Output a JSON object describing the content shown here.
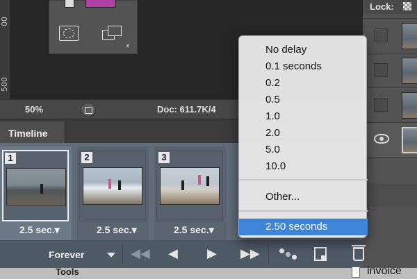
{
  "canvas": {
    "ruler_labels": [
      "00",
      "500"
    ],
    "swatch_colors": {
      "foreground": "#b03fa6",
      "background": "#dddddd"
    }
  },
  "status_bar": {
    "zoom": "50%",
    "doc_info": "Doc: 611.7K/4"
  },
  "layers": {
    "lock_label": "Lock:"
  },
  "timeline": {
    "tab_label": "Timeline",
    "frames": [
      {
        "number": "1",
        "delay": "2.5 sec.",
        "selected": true
      },
      {
        "number": "2",
        "delay": "2.5 sec.",
        "selected": false
      },
      {
        "number": "3",
        "delay": "2.5 sec.",
        "selected": false
      }
    ],
    "loop_label": "Forever",
    "controls": [
      "first-frame",
      "previous-frame",
      "play",
      "next-frame",
      "tween",
      "duplicate-frame",
      "delete-frame"
    ]
  },
  "delay_menu": {
    "items": [
      "No delay",
      "0.1 seconds",
      "0.2",
      "0.5",
      "1.0",
      "2.0",
      "5.0",
      "10.0"
    ],
    "other_label": "Other...",
    "current_label": "2.50 seconds",
    "highlight_color": "#3d84d8"
  },
  "bottom_strip": {
    "left_text": "Tools",
    "file_label": "invoice"
  }
}
